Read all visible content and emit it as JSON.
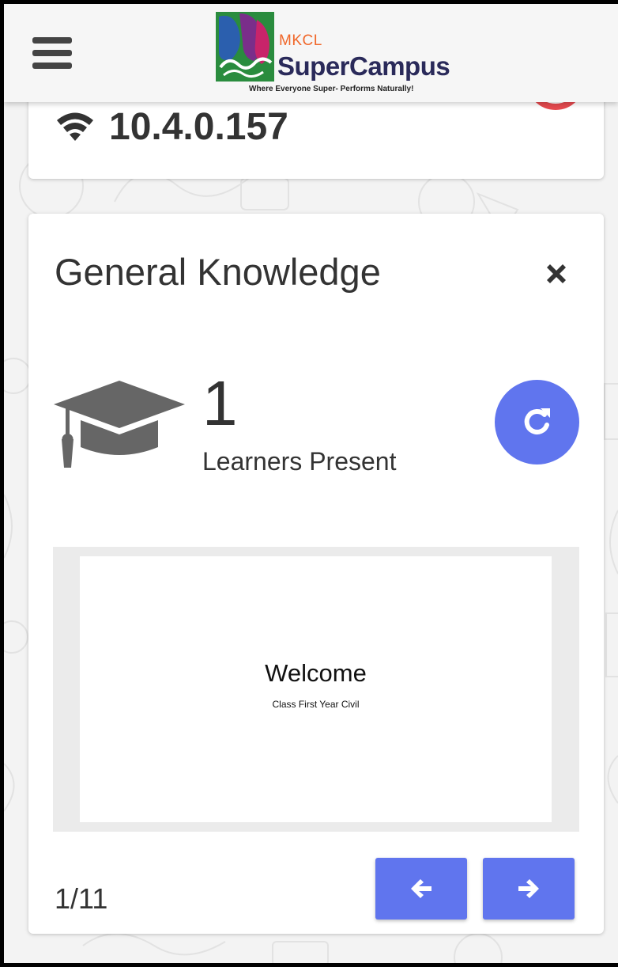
{
  "header": {
    "logo_small": "MKCL",
    "logo_big": "SuperCampus",
    "logo_tagline": "Where Everyone Super- Performs Naturally!"
  },
  "network": {
    "ip_address": "10.4.0.157",
    "wifi_icon": "wifi-icon",
    "status_color": "#e64a4f"
  },
  "session": {
    "title": "General Knowledge",
    "learners_count": "1",
    "learners_label": "Learners Present"
  },
  "slide": {
    "title": "Welcome",
    "subtitle": "Class First Year Civil"
  },
  "pager": {
    "indicator": "1/11"
  },
  "colors": {
    "accent": "#6075ee",
    "icon_gray": "#666666",
    "text": "#333333"
  }
}
